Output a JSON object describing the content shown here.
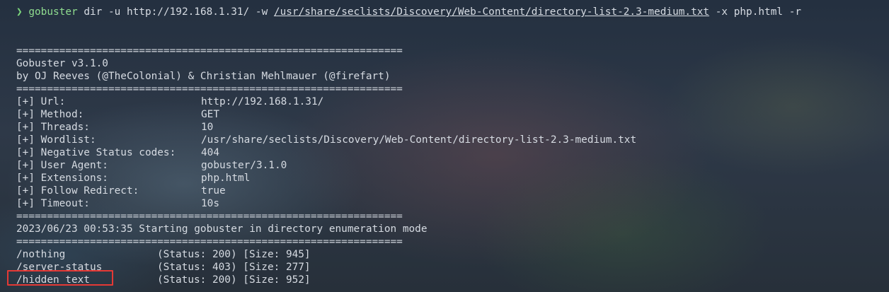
{
  "command": {
    "prompt": "❯",
    "program": "gobuster",
    "args_before": "dir -u http://192.168.1.31/ -w",
    "wordlist_path": "/usr/share/seclists/Discovery/Web-Content/directory-list-2.3-medium.txt",
    "args_after": "-x php.html -r"
  },
  "separator": "===============================================================",
  "banner": {
    "version": "Gobuster v3.1.0",
    "authors": "by OJ Reeves (@TheColonial) & Christian Mehlmauer (@firefart)"
  },
  "settings": [
    {
      "label": "[+] Url:",
      "value": "http://192.168.1.31/"
    },
    {
      "label": "[+] Method:",
      "value": "GET"
    },
    {
      "label": "[+] Threads:",
      "value": "10"
    },
    {
      "label": "[+] Wordlist:",
      "value": "/usr/share/seclists/Discovery/Web-Content/directory-list-2.3-medium.txt"
    },
    {
      "label": "[+] Negative Status codes:",
      "value": "404"
    },
    {
      "label": "[+] User Agent:",
      "value": "gobuster/3.1.0"
    },
    {
      "label": "[+] Extensions:",
      "value": "php.html"
    },
    {
      "label": "[+] Follow Redirect:",
      "value": "true"
    },
    {
      "label": "[+] Timeout:",
      "value": "10s"
    }
  ],
  "start_message": "2023/06/23 00:53:35 Starting gobuster in directory enumeration mode",
  "results": [
    {
      "path": "/nothing",
      "info": "(Status: 200) [Size: 945]"
    },
    {
      "path": "/server-status",
      "info": "(Status: 403) [Size: 277]"
    },
    {
      "path": "/hidden_text",
      "info": "(Status: 200) [Size: 952]"
    }
  ],
  "highlight_color": "#e53935"
}
